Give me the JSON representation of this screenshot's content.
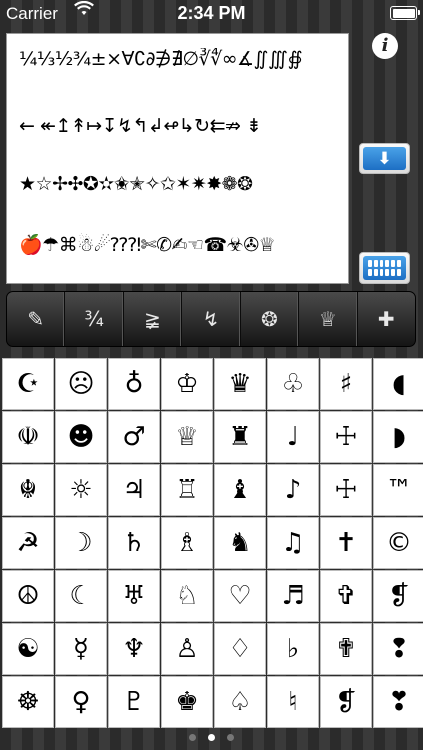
{
  "status_bar": {
    "carrier": "Carrier",
    "wifi_icon": "wifi-icon",
    "time": "2:34 PM",
    "battery_icon": "battery-icon"
  },
  "text_area": {
    "lines": [
      "¼⅓½¾±×∀∁∂∌∄∅∛∜∞∡∬∭∯",
      "← ↞↥↟↦↧↯↰↲↫↳↻⇇⇏ ⇟",
      "★☆✢✣✪✫✬✭✧✩✶✷✸❁❂",
      "🍎☂⌘☃☄⁇⁈✄✆✍☜☎☣✇♕"
    ]
  },
  "buttons": {
    "info_label": "i",
    "down_label": "⬇",
    "keyboard_icon": "keyboard-icon"
  },
  "toolbar": {
    "tools": [
      "✎",
      "¾",
      "≩",
      "↯",
      "❂",
      "♕",
      "✚"
    ]
  },
  "grid": {
    "symbols": [
      "☪",
      "☹",
      "♁",
      "♔",
      "♛",
      "♧",
      "♯",
      "◖",
      "☫",
      "☻",
      "♂",
      "♕",
      "♜",
      "♩",
      "☩",
      "◗",
      "☬",
      "☼",
      "♃",
      "♖",
      "♝",
      "♪",
      "☩",
      "™",
      "☭",
      "☽",
      "♄",
      "♗",
      "♞",
      "♫",
      "✝",
      "©",
      "☮",
      "☾",
      "♅",
      "♘",
      "♡",
      "♬",
      "✞",
      "❡",
      "☯",
      "☿",
      "♆",
      "♙",
      "♢",
      "♭",
      "✟",
      "❢",
      "☸",
      "♀",
      "♇",
      "♚",
      "♤",
      "♮",
      "❡",
      "❣"
    ]
  },
  "pager": {
    "pages": 3,
    "active": 2
  }
}
